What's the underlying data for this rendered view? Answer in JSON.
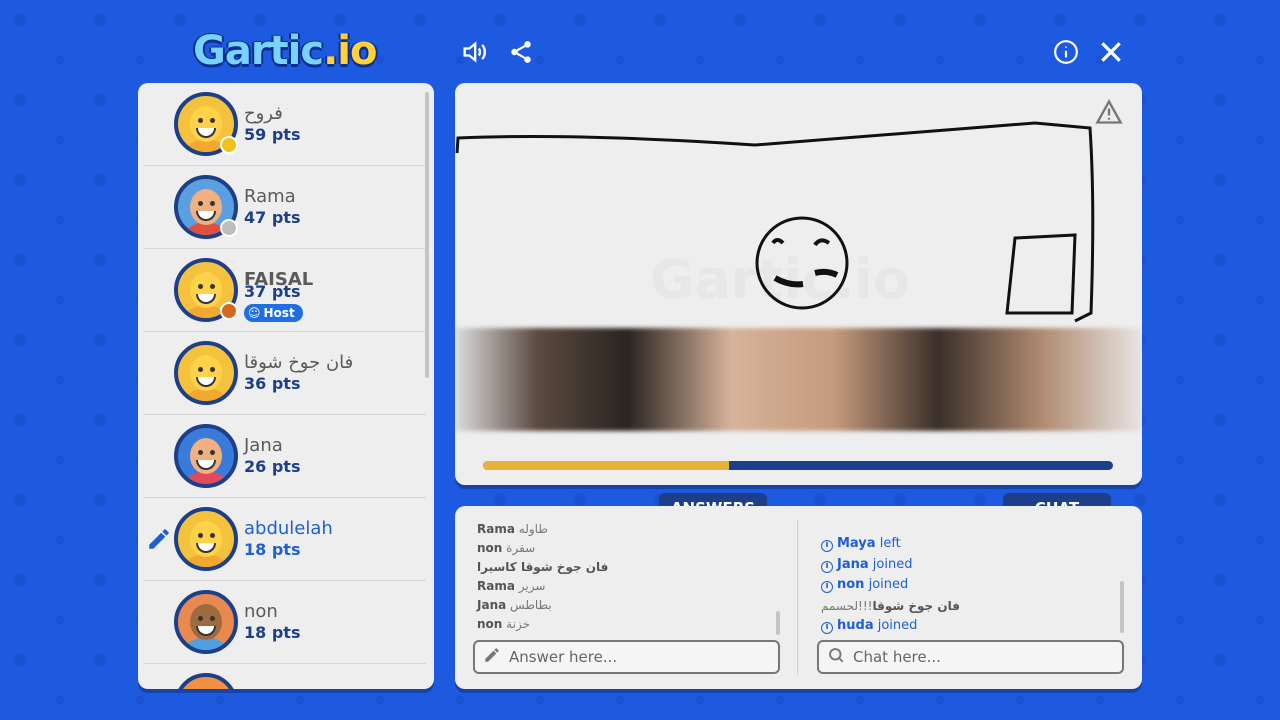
{
  "app": {
    "logo_main": "Gartic",
    "logo_suffix": ".io"
  },
  "players": [
    {
      "name": "فروح",
      "points": "59 pts",
      "dot_color": "#f1c21b"
    },
    {
      "name": "Rama",
      "points": "47 pts",
      "dot_color": "#bdbdbd"
    },
    {
      "name": "FAISAL",
      "points": "37 pts",
      "dot_color": "#d56a1d",
      "badge": "Host"
    },
    {
      "name": "فان جوخ شوقا",
      "points": "36 pts"
    },
    {
      "name": "Jana",
      "points": "26 pts"
    },
    {
      "name": "abdulelah",
      "points": "18 pts"
    },
    {
      "name": "non",
      "points": "18 pts"
    }
  ],
  "canvas": {
    "watermark": "Gartic.io",
    "time_remaining_fraction": 0.39
  },
  "tabs": {
    "answers": "ANSWERS",
    "chat": "CHAT"
  },
  "answers": [
    {
      "user": "Rama",
      "text": "طاوله"
    },
    {
      "user": "non",
      "text": "سفرة"
    },
    {
      "user": "",
      "text": "فان جوخ شوقا كاسيرا"
    },
    {
      "user": "Rama",
      "text": "سرير"
    },
    {
      "user": "Jana",
      "text": "بطاطس"
    },
    {
      "user": "non",
      "text": "خزنة"
    }
  ],
  "chat": [
    {
      "type": "system",
      "user": "Maya",
      "text": "left"
    },
    {
      "type": "system",
      "user": "Jana",
      "text": "joined"
    },
    {
      "type": "system",
      "user": "non",
      "text": "joined"
    },
    {
      "type": "message",
      "user": "فان جوخ شوقا",
      "text": "!!!لحسمم"
    },
    {
      "type": "system",
      "user": "huda",
      "text": "joined"
    }
  ],
  "inputs": {
    "answer_placeholder": "Answer here...",
    "chat_placeholder": "Chat here..."
  },
  "colors": {
    "background": "#1e5ae0",
    "navy": "#1d3f8a",
    "accent": "#1f5fd6",
    "timer": "#e7b23a"
  }
}
